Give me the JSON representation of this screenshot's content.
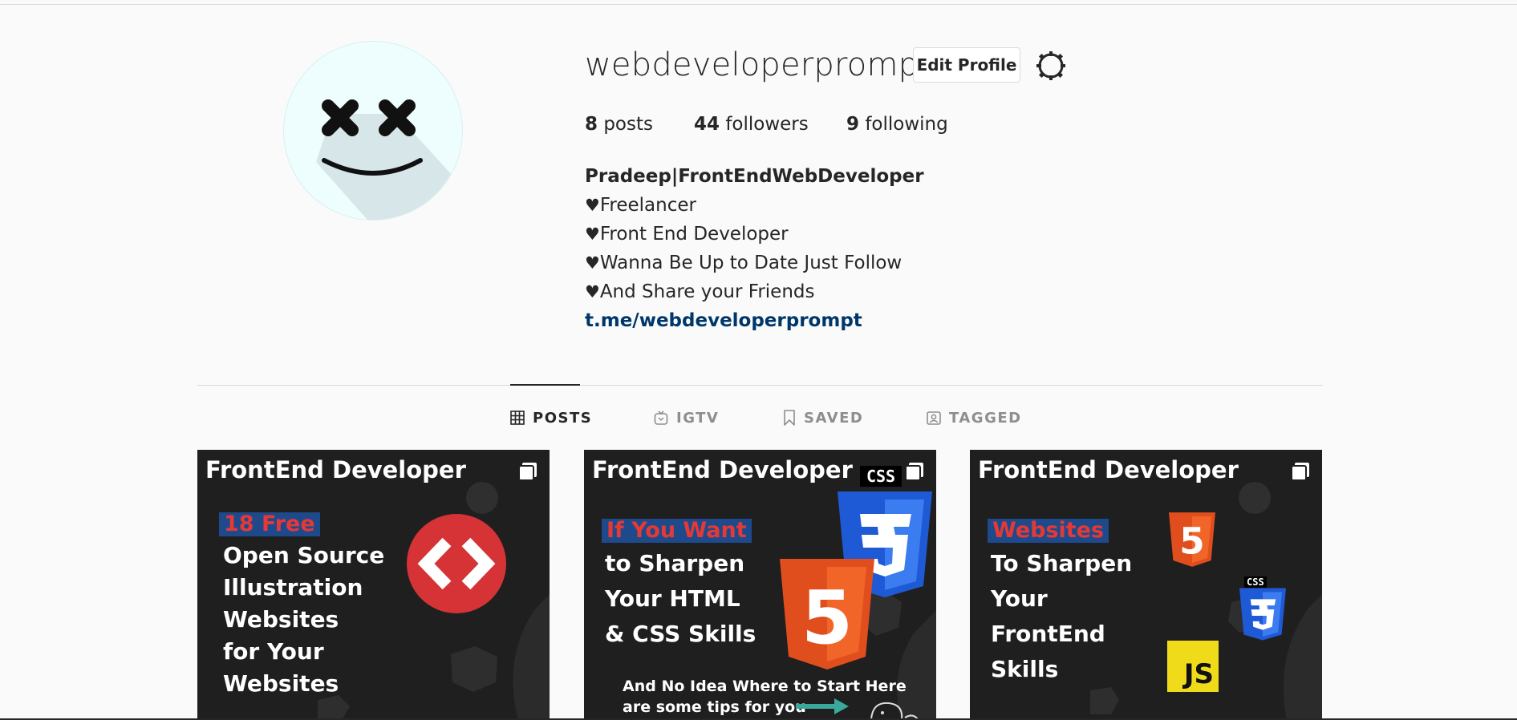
{
  "profile": {
    "username": "webdeveloperprompt",
    "edit_profile_label": "Edit Profile",
    "stats": {
      "posts_count": "8",
      "posts_label": "posts",
      "followers_count": "44",
      "followers_label": "followers",
      "following_count": "9",
      "following_label": "following"
    },
    "bio": {
      "full_name": "Pradeep|FrontEndWebDeveloper",
      "heart": "♥",
      "lines": [
        "Freelancer",
        "Front End Developer",
        "Wanna Be Up to Date Just Follow",
        "And Share your Friends"
      ],
      "link": "t.me/webdeveloperprompt"
    }
  },
  "tabs": [
    {
      "label": "POSTS",
      "icon": "grid-icon",
      "active": true
    },
    {
      "label": "IGTV",
      "icon": "igtv-icon",
      "active": false
    },
    {
      "label": "SAVED",
      "icon": "bookmark-icon",
      "active": false
    },
    {
      "label": "TAGGED",
      "icon": "tagged-icon",
      "active": false
    }
  ],
  "posts": [
    {
      "heading": "FrontEnd Developer",
      "highlight": "18 Free",
      "lines": [
        "Open Source",
        "Illustration",
        "Websites",
        "for Your",
        "Websites"
      ],
      "icon": "code-brackets-icon"
    },
    {
      "heading": "FrontEnd Developer",
      "highlight": "If You Want",
      "lines": [
        "to Sharpen",
        "Your HTML",
        "& CSS Skills"
      ],
      "small_lines": [
        "And No Idea Where to Start Here",
        "are some tips for you"
      ],
      "icons": [
        "css3-icon",
        "html5-icon"
      ],
      "badge_text": "CSS",
      "shield_number": "5"
    },
    {
      "heading": "FrontEnd Developer",
      "highlight": "Websites",
      "lines": [
        "To Sharpen",
        "Your",
        "FrontEnd",
        "Skills"
      ],
      "icons": [
        "html5-icon",
        "css3-icon",
        "js-icon"
      ],
      "badge_text": "CSS",
      "shield_number": "5",
      "js_text": "JS"
    }
  ],
  "colors": {
    "background": "#fafafa",
    "text": "#262626",
    "muted": "#8e8e8e",
    "link": "#00376b",
    "post_bg": "#1f1f1f",
    "highlight_red": "#e53935",
    "highlight_box": "#1e4a8c"
  }
}
